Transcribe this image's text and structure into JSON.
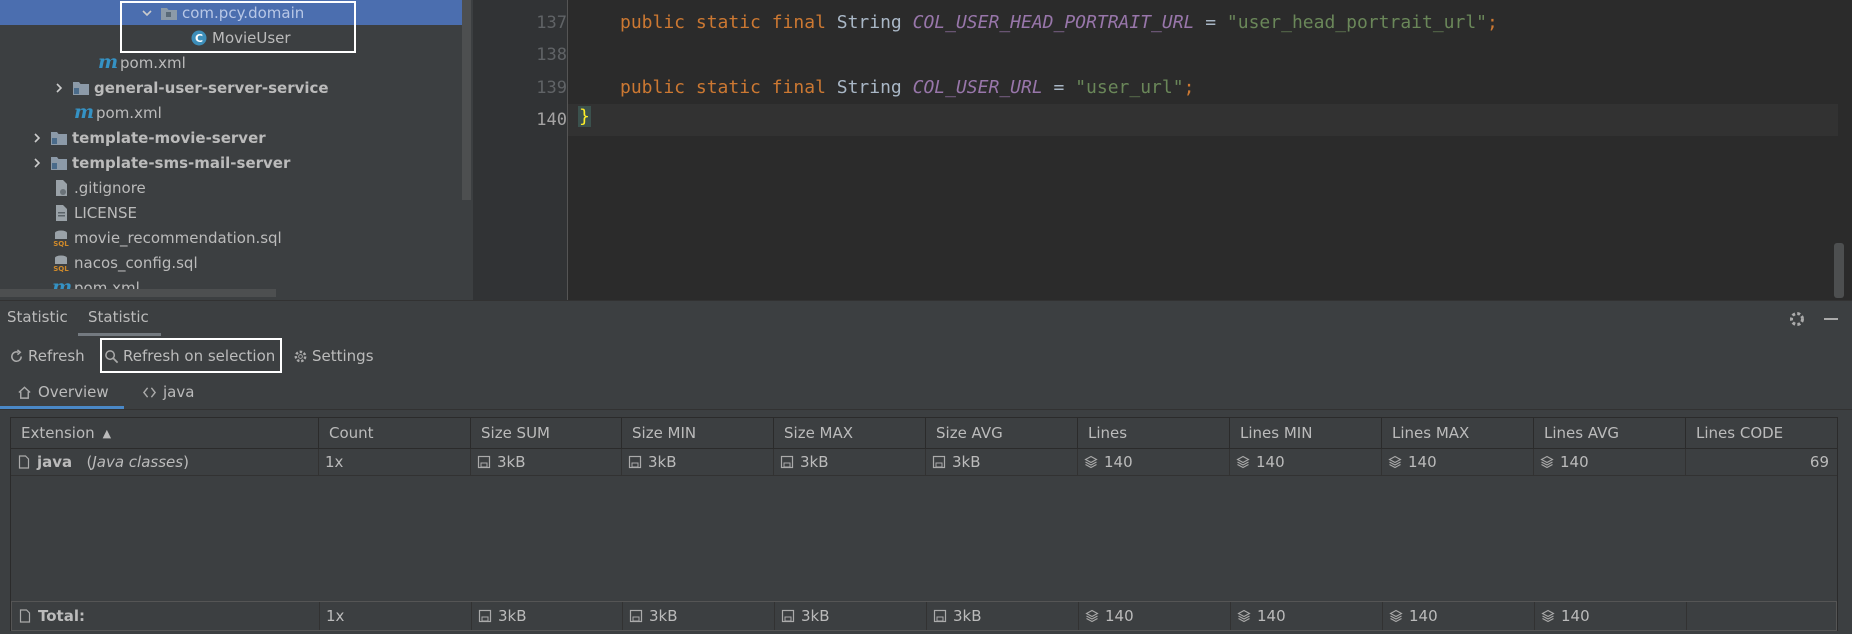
{
  "tree": {
    "items": [
      {
        "label": "com.pcy.domain",
        "kind": "package"
      },
      {
        "label": "MovieUser",
        "kind": "class"
      },
      {
        "label": "pom.xml",
        "kind": "maven"
      },
      {
        "label": "general-user-server-service",
        "kind": "module"
      },
      {
        "label": "pom.xml",
        "kind": "maven"
      },
      {
        "label": "template-movie-server",
        "kind": "module"
      },
      {
        "label": "template-sms-mail-server",
        "kind": "module"
      },
      {
        "label": ".gitignore",
        "kind": "file"
      },
      {
        "label": "LICENSE",
        "kind": "file"
      },
      {
        "label": "movie_recommendation.sql",
        "kind": "sql"
      },
      {
        "label": "nacos_config.sql",
        "kind": "sql"
      },
      {
        "label": "pom.xml",
        "kind": "maven"
      }
    ]
  },
  "editor": {
    "line_numbers": [
      "137",
      "138",
      "139",
      "140"
    ],
    "lines": [
      {
        "kw": "public static final",
        "type": "String",
        "const": "COL_USER_HEAD_PORTRAIT_URL",
        "eq": "=",
        "str": "\"user_head_portrait_url\"",
        "end": ";"
      },
      {
        "kw": "public static final",
        "type": "String",
        "const": "COL_USER_URL",
        "eq": "=",
        "str": "\"user_url\"",
        "end": ";"
      }
    ],
    "closing_brace": "}"
  },
  "panel": {
    "tabs": [
      "Statistic",
      "Statistic"
    ],
    "toolbar": {
      "refresh": "Refresh",
      "refresh_on_selection": "Refresh on selection",
      "settings": "Settings"
    },
    "file_tabs": [
      "Overview",
      "java"
    ],
    "columns": [
      "Extension",
      "Count",
      "Size SUM",
      "Size MIN",
      "Size MAX",
      "Size AVG",
      "Lines",
      "Lines MIN",
      "Lines MAX",
      "Lines AVG",
      "Lines CODE"
    ],
    "rows": [
      {
        "extension": "java",
        "desc": "Java classes",
        "count": "1x",
        "size_sum": "3kB",
        "size_min": "3kB",
        "size_max": "3kB",
        "size_avg": "3kB",
        "lines": "140",
        "lines_min": "140",
        "lines_max": "140",
        "lines_avg": "140",
        "lines_code": "69"
      }
    ],
    "total": {
      "label": "Total:",
      "count": "1x",
      "size_sum": "3kB",
      "size_min": "3kB",
      "size_max": "3kB",
      "size_avg": "3kB",
      "lines": "140",
      "lines_min": "140",
      "lines_max": "140",
      "lines_avg": "140",
      "lines_code": ""
    }
  },
  "colors": {
    "selection": "#4b6eaf",
    "keyword": "#cc7832",
    "constant": "#9876aa",
    "string": "#6a8759",
    "maven": "#3592c4"
  }
}
